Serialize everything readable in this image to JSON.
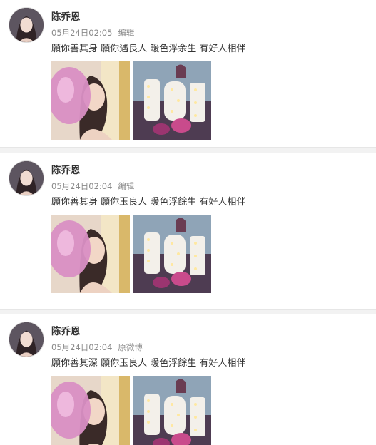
{
  "posts": [
    {
      "author": "陈乔恩",
      "time": "05月24日02:05",
      "source": "编辑",
      "content": "願你善其身 願你遇良人 暖色浮余生 有好人相伴",
      "images": [
        "selfie-with-pink-balloon",
        "marquee-letters-joe"
      ]
    },
    {
      "author": "陈乔恩",
      "time": "05月24日02:04",
      "source": "编辑",
      "content": "願你善其身 願你玉良人 暖色浮餘生 有好人相伴",
      "images": [
        "selfie-with-pink-balloon",
        "marquee-letters-joe"
      ]
    },
    {
      "author": "陈乔恩",
      "time": "05月24日02:04",
      "source": "原微博",
      "content": "願你善其深 願你玉良人 暖色浮餘生 有好人相伴",
      "images": [
        "selfie-with-pink-balloon",
        "marquee-letters-joe"
      ]
    }
  ],
  "colors": {
    "name": "#333333",
    "meta": "#8a8a8a",
    "separator": "#f2f2f2"
  }
}
